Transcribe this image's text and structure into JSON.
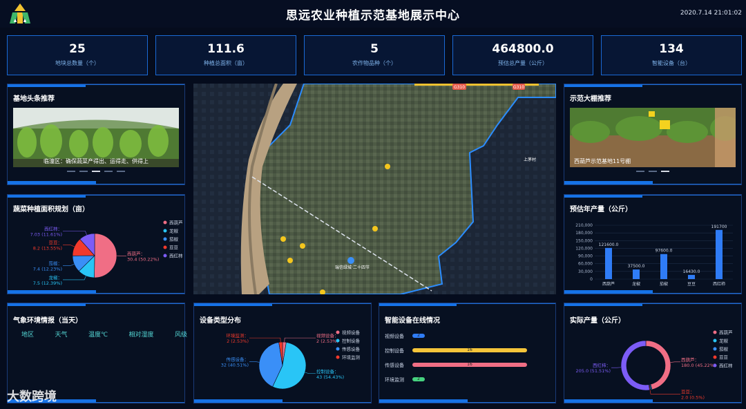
{
  "header": {
    "title": "思远农业种植示范基地展示中心",
    "datetime": "2020.7.14 21:01:02"
  },
  "stats": [
    {
      "value": "25",
      "label": "地块总数量（个）"
    },
    {
      "value": "111.6",
      "label": "种植总面积（亩）"
    },
    {
      "value": "5",
      "label": "农作物品种（个）"
    },
    {
      "value": "464800.0",
      "label": "预估总产量（公斤）"
    },
    {
      "value": "134",
      "label": "智能设备（台）"
    }
  ],
  "left_top": {
    "title": "基地头条推荐",
    "caption": "临潼区：确保蔬菜产得出、运得走、供得上"
  },
  "right_top": {
    "title": "示范大棚推荐",
    "caption": "西葫芦示范基地11号棚"
  },
  "planting_pie": {
    "title": "蔬菜种植面积规划（亩）"
  },
  "estimate_bar": {
    "title": "预估年产量（公斤）"
  },
  "weather": {
    "title": "气象环境情报（当天）",
    "columns": [
      "地区",
      "天气",
      "温度℃",
      "相对湿度",
      "风级"
    ]
  },
  "device_type": {
    "title": "设备类型分布"
  },
  "online": {
    "title": "智能设备在线情况",
    "rows": [
      {
        "label": "视频设备",
        "value": "2",
        "fraction": 0.1,
        "color": "#2f7cf6"
      },
      {
        "label": "控制设备",
        "value": "16",
        "fraction": 1.0,
        "color": "#f5c53a"
      },
      {
        "label": "传感设备",
        "value": "16",
        "fraction": 1.0,
        "color": "#f06e85"
      },
      {
        "label": "环境监测",
        "value": "2",
        "fraction": 0.1,
        "color": "#46d27f"
      }
    ]
  },
  "actual": {
    "title": "实际产量（公斤）"
  },
  "map_labels": {
    "road": "G310",
    "roundabout": "瑞信绿城·二十四节",
    "ne_village": "上茅村"
  },
  "watermark": "大数跨境",
  "chart_data": [
    {
      "type": "pie",
      "name": "planting",
      "slices": [
        {
          "label": "西葫芦",
          "value": 30.4,
          "text": "西葫芦：30.4 (50.22%)",
          "color": "#f06e85"
        },
        {
          "label": "龙椒",
          "value": 7.5,
          "text": "龙椒：7.5 (12.39%)",
          "color": "#29c5f6"
        },
        {
          "label": "茄椒",
          "value": 7.4,
          "text": "茄椒：7.4 (12.23%)",
          "color": "#3a8ff7"
        },
        {
          "label": "豆豆",
          "value": 8.2,
          "text": "豆豆：8.2 (13.55%)",
          "color": "#f23a2c"
        },
        {
          "label": "西红柿",
          "value": 7.03,
          "text": "西红柿：7.03 (11.61%)",
          "color": "#7c5cf6"
        }
      ],
      "legend": [
        "西葫芦",
        "龙椒",
        "茄椒",
        "豆豆",
        "西红柿"
      ]
    },
    {
      "type": "bar",
      "name": "estimate",
      "categories": [
        "西葫芦",
        "龙椒",
        "茄椒",
        "豆豆",
        "西红柿"
      ],
      "values": [
        121600,
        37500,
        97600,
        16430,
        191700
      ],
      "labels": [
        "121600.0",
        "37500.0",
        "97600.0",
        "16430.0",
        "191700"
      ],
      "yticks": [
        "210,000",
        "180,000",
        "150,000",
        "120,000",
        "90,000",
        "60,000",
        "30,000",
        "0"
      ],
      "ylim": [
        0,
        210000
      ],
      "color": "#2f7cf6"
    },
    {
      "type": "pie",
      "name": "device_type",
      "slices": [
        {
          "label": "视频设备",
          "value": 2,
          "text": "视频设备：2 (2.53%)",
          "color": "#f06e85"
        },
        {
          "label": "控制设备",
          "value": 43,
          "text": "控制设备：43 (54.43%)",
          "color": "#29c5f6"
        },
        {
          "label": "传感设备",
          "value": 32,
          "text": "传感设备：32 (40.51%)",
          "color": "#3a8ff7"
        },
        {
          "label": "环境监测",
          "value": 2,
          "text": "环境监测：2 (2.53%)",
          "color": "#f23a2c"
        }
      ],
      "legend": [
        "视频设备",
        "控制设备",
        "传感设备",
        "环境监测"
      ]
    },
    {
      "type": "pie",
      "name": "actual",
      "donut": true,
      "slices": [
        {
          "label": "西葫芦",
          "value": 180,
          "text": "西葫芦：180.0 (45.22%)",
          "color": "#f06e85"
        },
        {
          "label": "龙椒",
          "value": 2,
          "text": "",
          "color": "#29c5f6"
        },
        {
          "label": "茄椒",
          "value": 2,
          "text": "",
          "color": "#3a8ff7"
        },
        {
          "label": "豆豆",
          "value": 2,
          "text": "豆豆：2.0 (0.5%)",
          "color": "#f23a2c"
        },
        {
          "label": "西红柿",
          "value": 205,
          "text": "西红柿：205.0 (51.51%)",
          "color": "#7c5cf6"
        }
      ],
      "legend": [
        "西葫芦",
        "龙椒",
        "茄椒",
        "豆豆",
        "西红柿"
      ]
    }
  ]
}
